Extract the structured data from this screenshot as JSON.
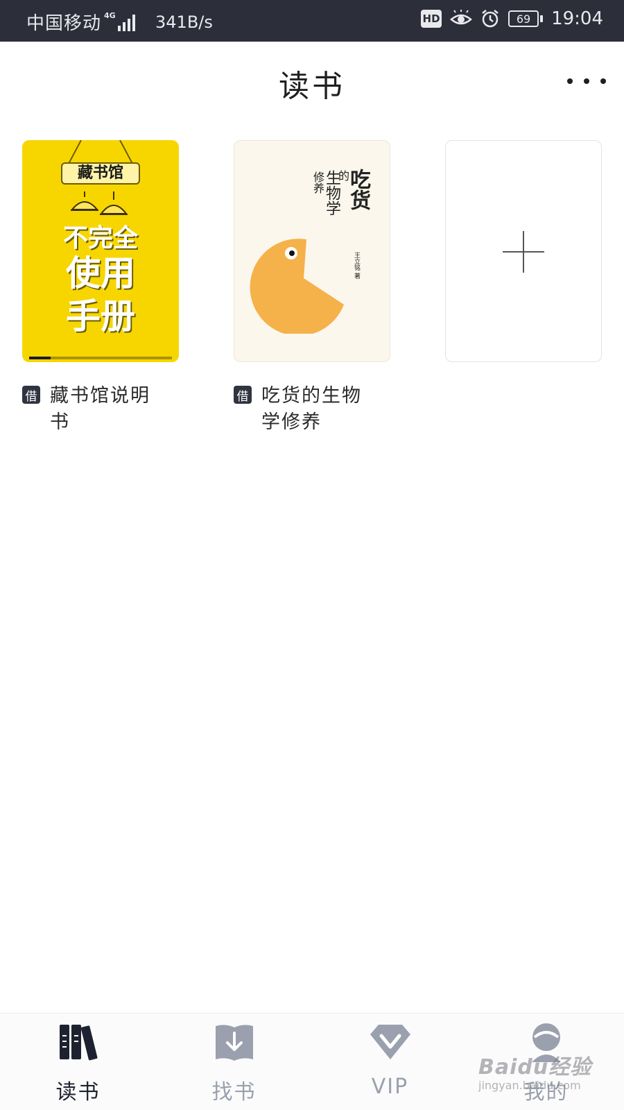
{
  "status_bar": {
    "carrier": "中国移动",
    "network": "4G",
    "speed": "341B/s",
    "hd": "HD",
    "battery": "69",
    "time": "19:04"
  },
  "header": {
    "title": "读书"
  },
  "books": [
    {
      "badge": "借",
      "title": "藏书馆说明书",
      "cover": {
        "banner": "藏书馆",
        "line1": "不完全",
        "line2": "使用",
        "line3": "手册",
        "reading_progress": 0.15
      }
    },
    {
      "badge": "借",
      "title": "吃货的生物学修养",
      "cover": {
        "title_part1": "吃货",
        "title_part2": "的",
        "title_part3": "生物学",
        "title_part4": "修养",
        "author": "王立铭 著"
      }
    }
  ],
  "add_slot": {
    "icon": "plus-icon"
  },
  "bottom_nav": [
    {
      "label": "读书",
      "icon": "bookshelf-icon",
      "active": true
    },
    {
      "label": "找书",
      "icon": "download-book-icon",
      "active": false
    },
    {
      "label": "VIP",
      "icon": "diamond-icon",
      "active": false
    },
    {
      "label": "我的",
      "icon": "profile-icon",
      "active": false
    }
  ],
  "watermark": {
    "main": "Baidu经验",
    "sub": "jingyan.baidu.com"
  },
  "colors": {
    "status_bar_bg": "#2c2f39",
    "nav_active": "#1e2230",
    "nav_inactive": "#9aa0ad",
    "cover_yellow": "#f7d600",
    "pacman_orange": "#f5b14a"
  }
}
